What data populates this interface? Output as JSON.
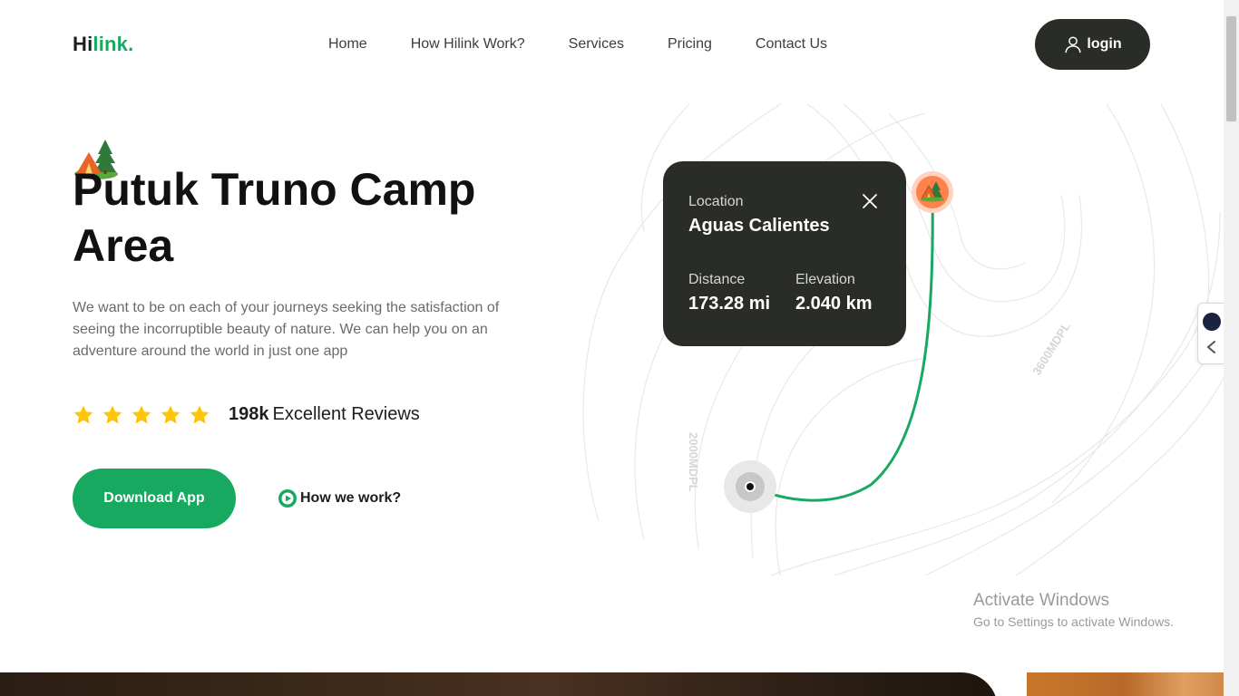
{
  "header": {
    "logo_part1": "Hi",
    "logo_part2": "link.",
    "nav": [
      "Home",
      "How Hilink Work?",
      "Services",
      "Pricing",
      "Contact Us"
    ],
    "login_label": "login"
  },
  "hero": {
    "title": "Putuk Truno Camp Area",
    "description": "We want to be on each of your journeys seeking the satisfaction of seeing the incorruptible beauty of nature. We can help you on an adventure around the world in just one app",
    "rating_stars": 5,
    "reviews_count": "198k",
    "reviews_label": "Excellent Reviews",
    "download_label": "Download App",
    "howwork_label": "How we work?"
  },
  "map_card": {
    "location_label": "Location",
    "location_value": "Aguas Calientes",
    "distance_label": "Distance",
    "distance_value": "173.28 mi",
    "elevation_label": "Elevation",
    "elevation_value": "2.040 km"
  },
  "map": {
    "contour_label_1": "3600MDPL",
    "contour_label_2": "2000MDPL"
  },
  "system": {
    "activate_title": "Activate Windows",
    "activate_sub": "Go to Settings to activate Windows."
  },
  "colors": {
    "brand_green": "#18a960",
    "dark": "#292c27",
    "star": "#fec601",
    "pin_orange": "#ff814c"
  }
}
